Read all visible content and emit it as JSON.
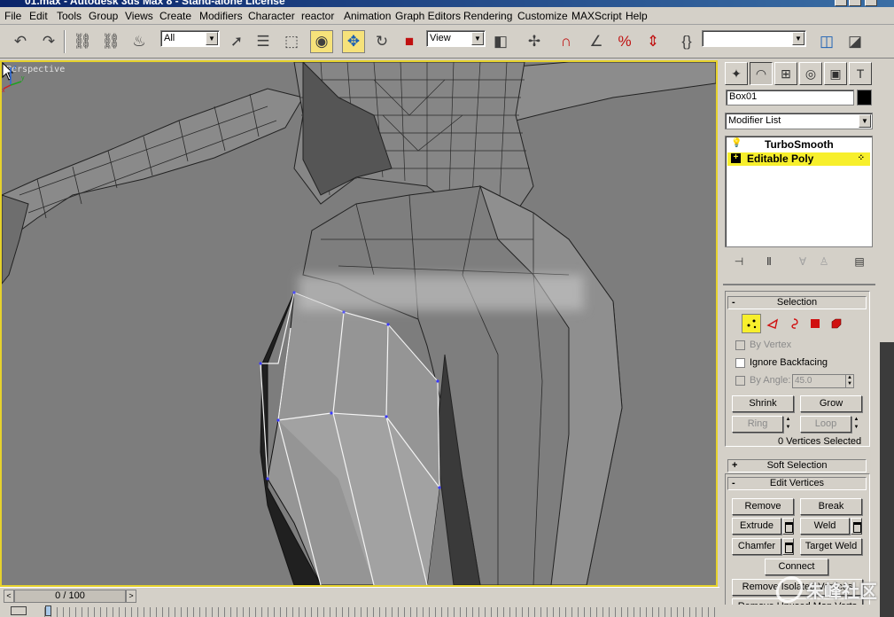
{
  "window": {
    "title": "01.max - Autodesk 3ds Max 8 - Stand-alone License"
  },
  "menubar": {
    "items": [
      "File",
      "Edit",
      "Tools",
      "Group",
      "Views",
      "Create",
      "Modifiers",
      "Character",
      "reactor",
      "Animation",
      "Graph Editors",
      "Rendering",
      "Customize",
      "MAXScript",
      "Help"
    ]
  },
  "toolbar": {
    "selection_filter": "All",
    "reference_coord": "View",
    "named_selection": "",
    "icons": [
      "undo-icon",
      "redo-icon",
      "select-link-icon",
      "unlink-icon",
      "bind-space-warp-icon",
      "select-object-icon",
      "select-by-name-icon",
      "rectangular-region-icon",
      "window-crossing-icon",
      "move-icon",
      "rotate-icon",
      "scale-icon",
      "pivot-center-icon",
      "manipulate-icon",
      "snap-3d-icon",
      "angle-snap-icon",
      "percent-snap-icon",
      "spinner-snap-icon",
      "edit-named-selections-icon",
      "mirror-icon",
      "align-icon"
    ],
    "active_tool": "move"
  },
  "viewport": {
    "label": "Perspective",
    "border_color": "#e6d22c",
    "background_color": "#7d7d7d",
    "axes": [
      "x",
      "y",
      "z"
    ]
  },
  "command_panel": {
    "tabs": [
      "create",
      "modify",
      "hierarchy",
      "motion",
      "display",
      "utilities"
    ],
    "active_tab": "modify",
    "object_name": "Box01",
    "object_color": "#000000",
    "modifier_list_label": "Modifier List",
    "stack": [
      {
        "name": "TurboSmooth",
        "selected": false,
        "icon": "lightbulb-icon"
      },
      {
        "name": "Editable Poly",
        "selected": true,
        "icon": "expand-plus-icon"
      }
    ],
    "stack_tools": [
      "pin-stack-icon",
      "show-end-result-icon",
      "make-unique-icon",
      "remove-modifier-icon",
      "configure-sets-icon"
    ]
  },
  "rollouts": {
    "selection": {
      "title": "Selection",
      "sign": "-",
      "subobject_levels": [
        "vertex",
        "edge",
        "border",
        "polygon",
        "element"
      ],
      "active_level": "vertex",
      "by_vertex": "By Vertex",
      "ignore_backfacing": "Ignore Backfacing",
      "by_angle": "By Angle:",
      "by_angle_value": "45.0",
      "shrink": "Shrink",
      "grow": "Grow",
      "ring": "Ring",
      "loop": "Loop",
      "status": "0 Vertices Selected"
    },
    "soft_selection": {
      "title": "Soft Selection",
      "sign": "+"
    },
    "edit_vertices": {
      "title": "Edit Vertices",
      "sign": "-",
      "remove": "Remove",
      "break": "Break",
      "extrude": "Extrude",
      "weld": "Weld",
      "chamfer": "Chamfer",
      "target_weld": "Target Weld",
      "connect": "Connect",
      "remove_isolated": "Remove Isolated Vertices",
      "remove_unused": "Remove Unused Map Verts"
    }
  },
  "timeline": {
    "frame_label": "0 / 100",
    "prev": "<",
    "next": ">"
  },
  "watermark": {
    "text": "朱峰社区"
  }
}
